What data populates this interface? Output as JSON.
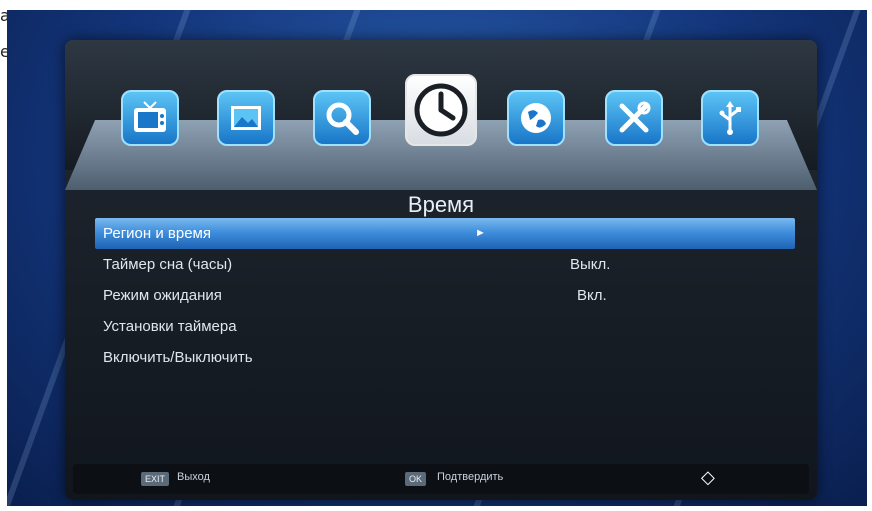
{
  "edge_chars": [
    "а",
    "е"
  ],
  "icons": [
    {
      "name": "tv-icon",
      "active": false
    },
    {
      "name": "picture-icon",
      "active": false
    },
    {
      "name": "search-icon",
      "active": false
    },
    {
      "name": "clock-icon",
      "active": true
    },
    {
      "name": "globe-icon",
      "active": false
    },
    {
      "name": "tools-icon",
      "active": false
    },
    {
      "name": "usb-icon",
      "active": false
    }
  ],
  "title": "Время",
  "menu": [
    {
      "label": "Регион и время",
      "value": "",
      "selected": true,
      "arrow": "►"
    },
    {
      "label": "Таймер сна (часы)",
      "value": "Выкл.",
      "selected": false
    },
    {
      "label": "Режим ожидания",
      "value": "Вкл.",
      "selected": false
    },
    {
      "label": "Установки таймера",
      "value": "",
      "selected": false
    },
    {
      "label": "Включить/Выключить",
      "value": "",
      "selected": false
    }
  ],
  "footer": {
    "exit_key": "EXIT",
    "exit_label": "Выход",
    "ok_key": "OK",
    "ok_label": "Подтвердить",
    "nav_glyph": "◇"
  },
  "colors": {
    "accent": "#3f8fdc",
    "icon_blue": "#1976c8",
    "background": "#13357a"
  }
}
